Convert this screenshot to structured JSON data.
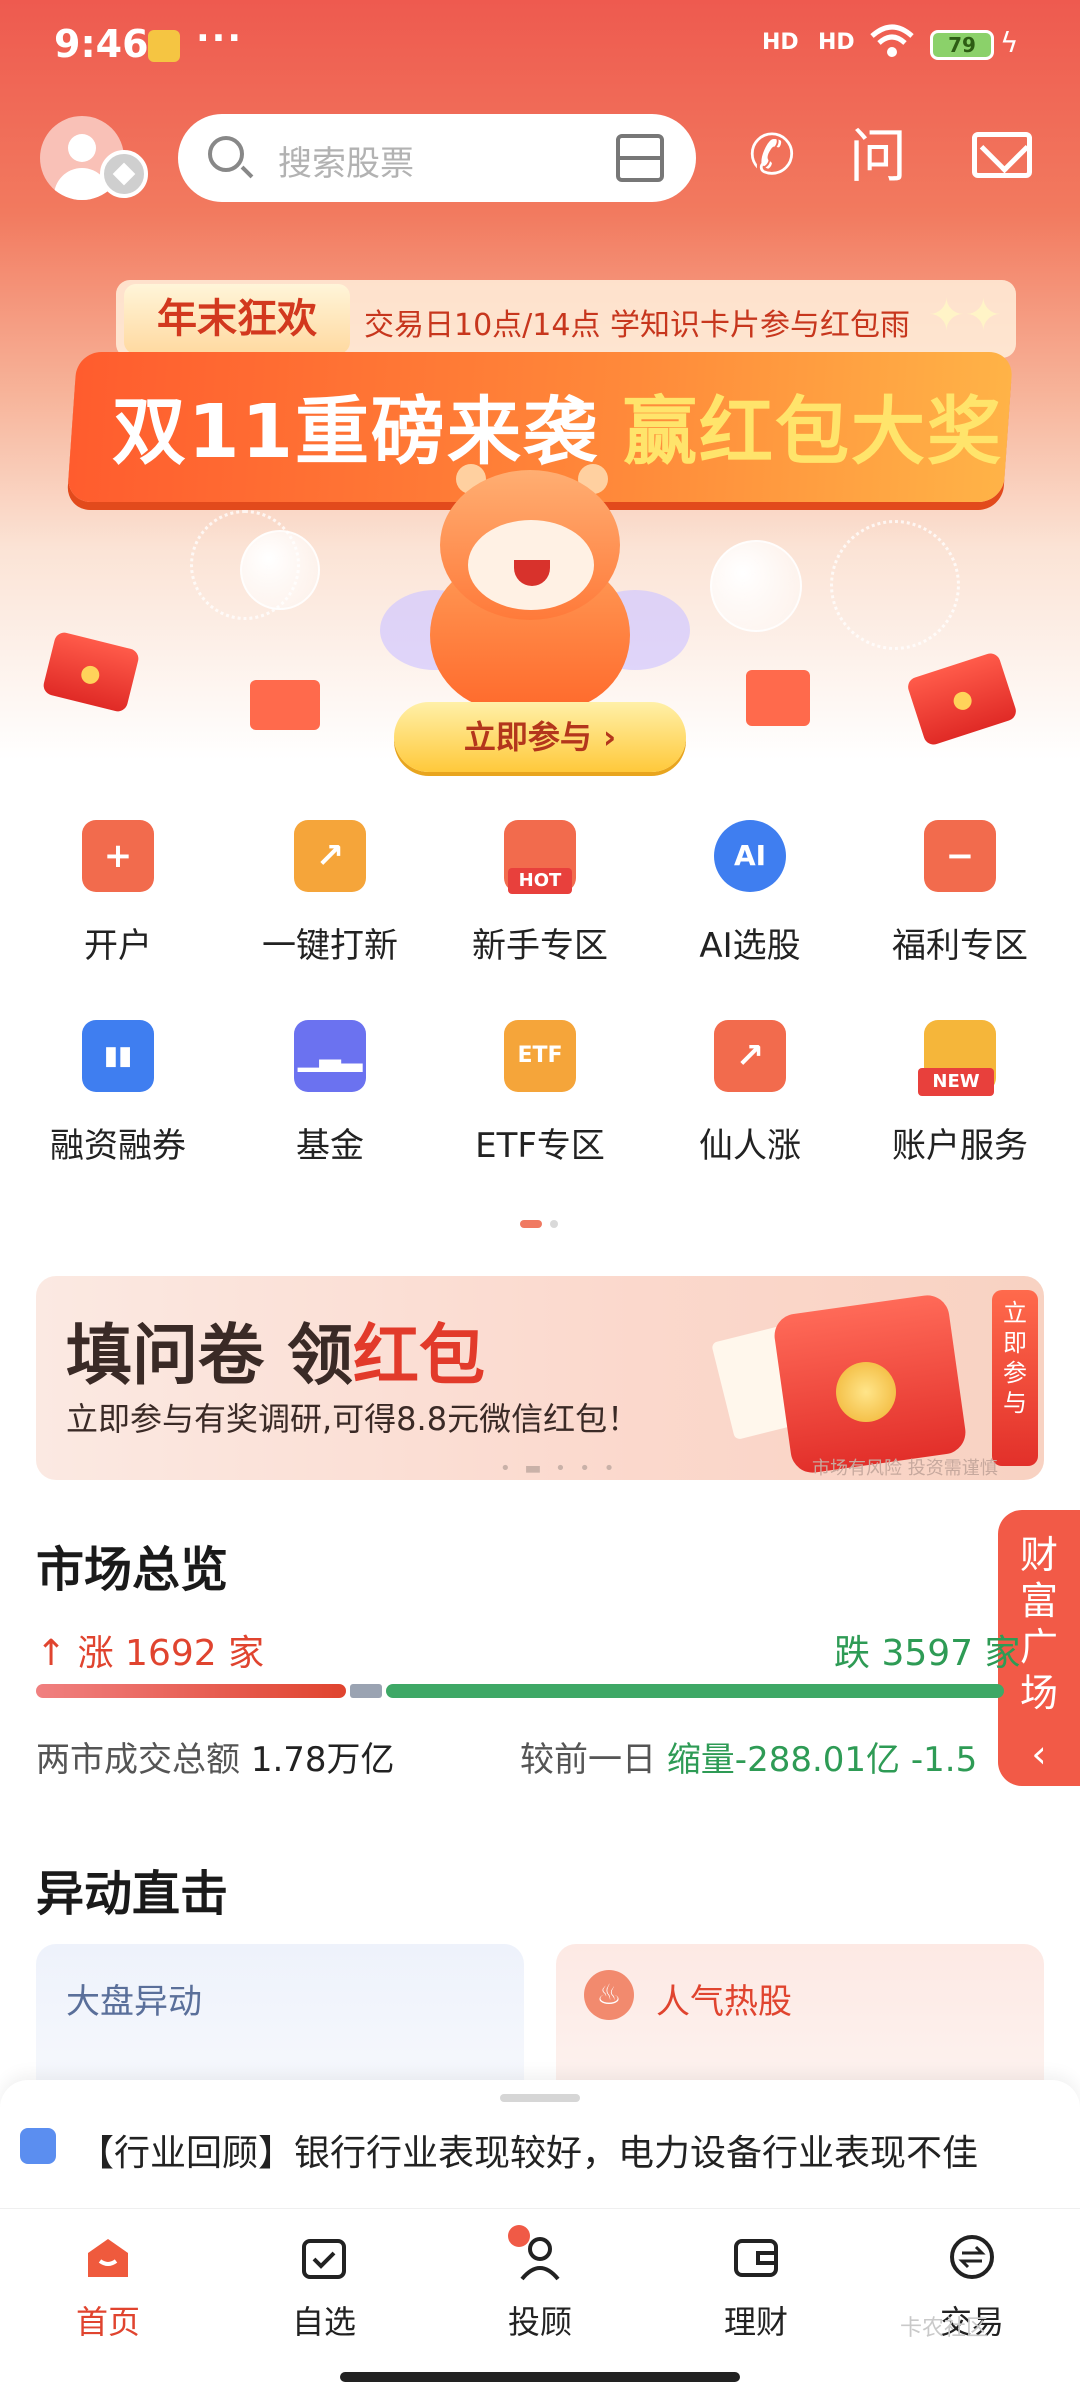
{
  "status_bar": {
    "time": "9:46",
    "more": "···",
    "signal_1": "HD",
    "signal_2": "HD",
    "battery": "79"
  },
  "header": {
    "search_placeholder": "搜索股票",
    "phone_icon": "phone-icon",
    "ask_label": "问",
    "mail_icon": "mail-icon"
  },
  "banner": {
    "tag": "年末狂欢",
    "subtitle": "交易日10点/14点 学知识卡片参与红包雨",
    "headline_a": "双11重磅来袭",
    "headline_b": "赢红包大奖",
    "cta": "立即参与 ›"
  },
  "grid": [
    {
      "label": "开户",
      "icon": "open-account-icon",
      "color": "#f26b4d"
    },
    {
      "label": "一键打新",
      "icon": "ipo-icon",
      "color": "#f5a53a"
    },
    {
      "label": "新手专区",
      "icon": "newbie-icon",
      "color": "#f26b4d",
      "badge": "HOT"
    },
    {
      "label": "AI选股",
      "icon": "ai-icon",
      "color": "#3f7ef0",
      "glyph": "AI"
    },
    {
      "label": "福利专区",
      "icon": "gift-icon",
      "color": "#f26b4d"
    },
    {
      "label": "融资融券",
      "icon": "margin-icon",
      "color": "#3f7ef0"
    },
    {
      "label": "基金",
      "icon": "fund-icon",
      "color": "#6b72f0"
    },
    {
      "label": "ETF专区",
      "icon": "etf-icon",
      "color": "#f5a53a",
      "glyph": "ETF"
    },
    {
      "label": "仙人涨",
      "icon": "trend-icon",
      "color": "#f26b4d"
    },
    {
      "label": "账户服务",
      "icon": "account-service-icon",
      "color": "#f5b63a",
      "badge": "NEW"
    }
  ],
  "survey": {
    "title_a": "填问卷 领",
    "title_b": "红包",
    "subtitle": "立即参与有奖调研,可得8.8元微信红包！",
    "side": "立即参与",
    "risk": "市场有风险 投资需谨慎"
  },
  "float_side": {
    "text": "财富广场",
    "chevron": "‹"
  },
  "market": {
    "title": "市场总览",
    "up_label": "涨 1692 家",
    "down_label": "跌 3597 家",
    "up_count": 1692,
    "down_count": 3597,
    "turnover_label": "两市成交总额",
    "turnover_value": "1.78万亿",
    "compare_label": "较前一日",
    "compare_value": "缩量-288.01亿",
    "compare_pct": "-1.5"
  },
  "alerts": {
    "title": "异动直击",
    "left_caption": "大盘异动",
    "right_caption": "人气热股"
  },
  "news": {
    "text": "【行业回顾】银行行业表现较好，电力设备行业表现不佳"
  },
  "tabs": [
    {
      "label": "首页",
      "icon": "home-icon"
    },
    {
      "label": "自选",
      "icon": "watchlist-icon"
    },
    {
      "label": "投顾",
      "icon": "advisor-icon"
    },
    {
      "label": "理财",
      "icon": "wallet-icon"
    },
    {
      "label": "交易",
      "icon": "trade-icon"
    }
  ],
  "watermark": "卡农社区"
}
